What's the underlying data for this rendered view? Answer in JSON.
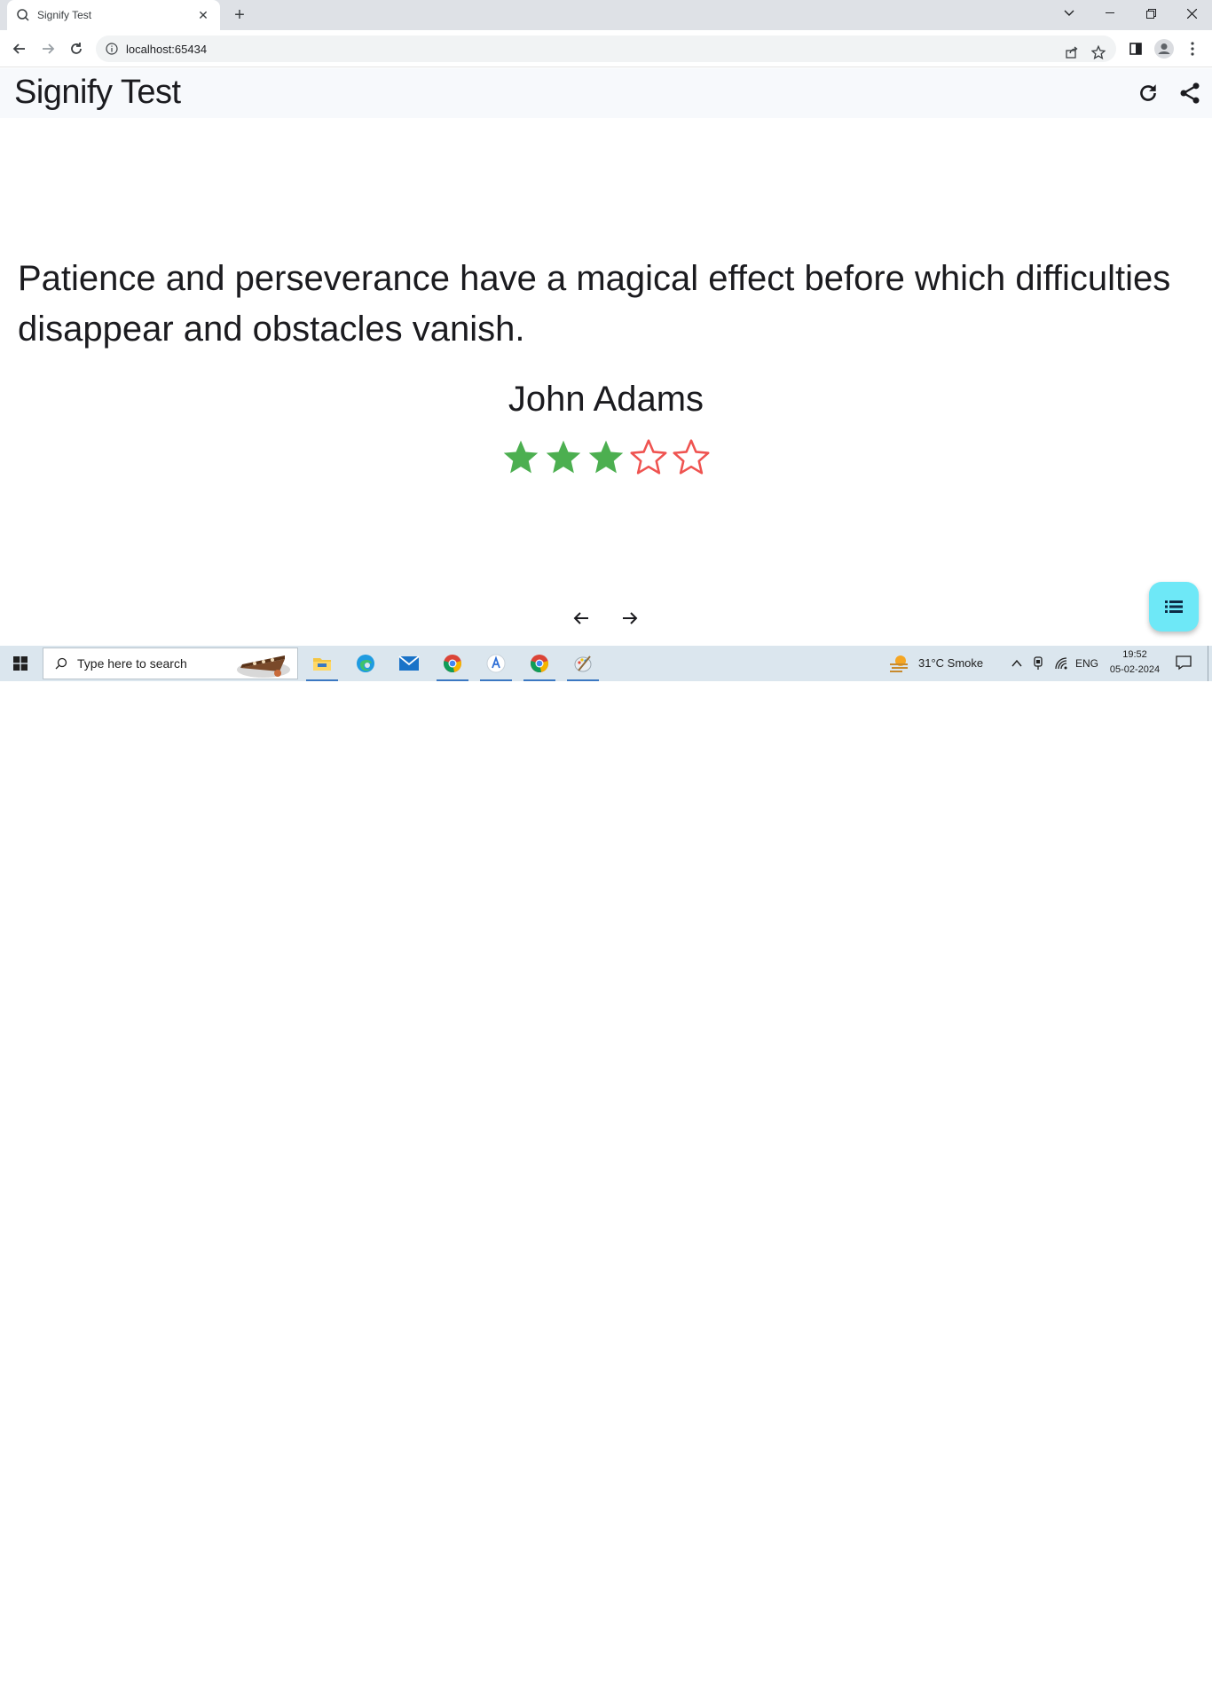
{
  "browser": {
    "tab_title": "Signify Test",
    "url": "localhost:65434"
  },
  "app": {
    "title": "Signify Test"
  },
  "quote": {
    "text": "Patience and perseverance have a magical effect before which difficulties disappear and obstacles vanish.",
    "author": "John Adams",
    "rating": 3,
    "rating_max": 5,
    "filled_color": "#4caf50",
    "empty_color": "#ef5350"
  },
  "fab_color": "#6ee8f7",
  "taskbar": {
    "search_placeholder": "Type here to search",
    "weather": "31°C  Smoke",
    "language": "ENG",
    "time": "19:52",
    "date": "05-02-2024"
  }
}
